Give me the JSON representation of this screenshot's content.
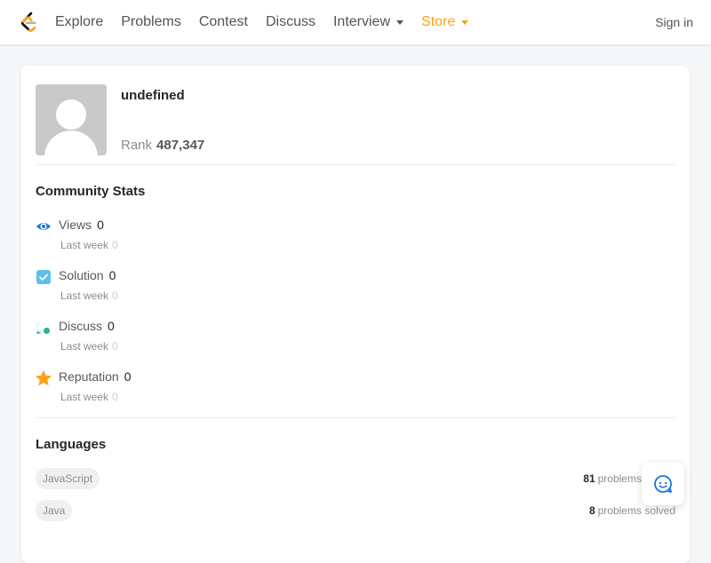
{
  "nav": {
    "logo_icon": "leetcode-logo-icon",
    "items": [
      {
        "label": "Explore"
      },
      {
        "label": "Problems"
      },
      {
        "label": "Contest"
      },
      {
        "label": "Discuss"
      },
      {
        "label": "Interview"
      },
      {
        "label": "Store"
      }
    ],
    "sign_in": "Sign in",
    "store_color": "#ffa116"
  },
  "profile": {
    "avatar_icon": "default-avatar-icon",
    "username": "undefined",
    "rank_label": "Rank",
    "rank_value": "487,347"
  },
  "community": {
    "title": "Community Stats",
    "stats": [
      {
        "icon": "eye-icon",
        "label": "Views",
        "value": "0",
        "sub_label": "Last week",
        "sub_value": "0",
        "color": "#1a73e8"
      },
      {
        "icon": "solution-check-icon",
        "label": "Solution",
        "value": "0",
        "sub_label": "Last week",
        "sub_value": "0",
        "color": "#5bc0eb"
      },
      {
        "icon": "discuss-bubble-icon",
        "label": "Discuss",
        "value": "0",
        "sub_label": "Last week",
        "sub_value": "0",
        "color": "#2db59a"
      },
      {
        "icon": "star-icon",
        "label": "Reputation",
        "value": "0",
        "sub_label": "Last week",
        "sub_value": "0",
        "color": "#ffa116"
      }
    ]
  },
  "languages": {
    "title": "Languages",
    "items": [
      {
        "name": "JavaScript",
        "count": "81",
        "suffix": "problems solved"
      },
      {
        "name": "Java",
        "count": "8",
        "suffix": "problems solved"
      }
    ]
  },
  "feedback": {
    "icon": "feedback-chat-icon",
    "color": "#1a73e8"
  }
}
